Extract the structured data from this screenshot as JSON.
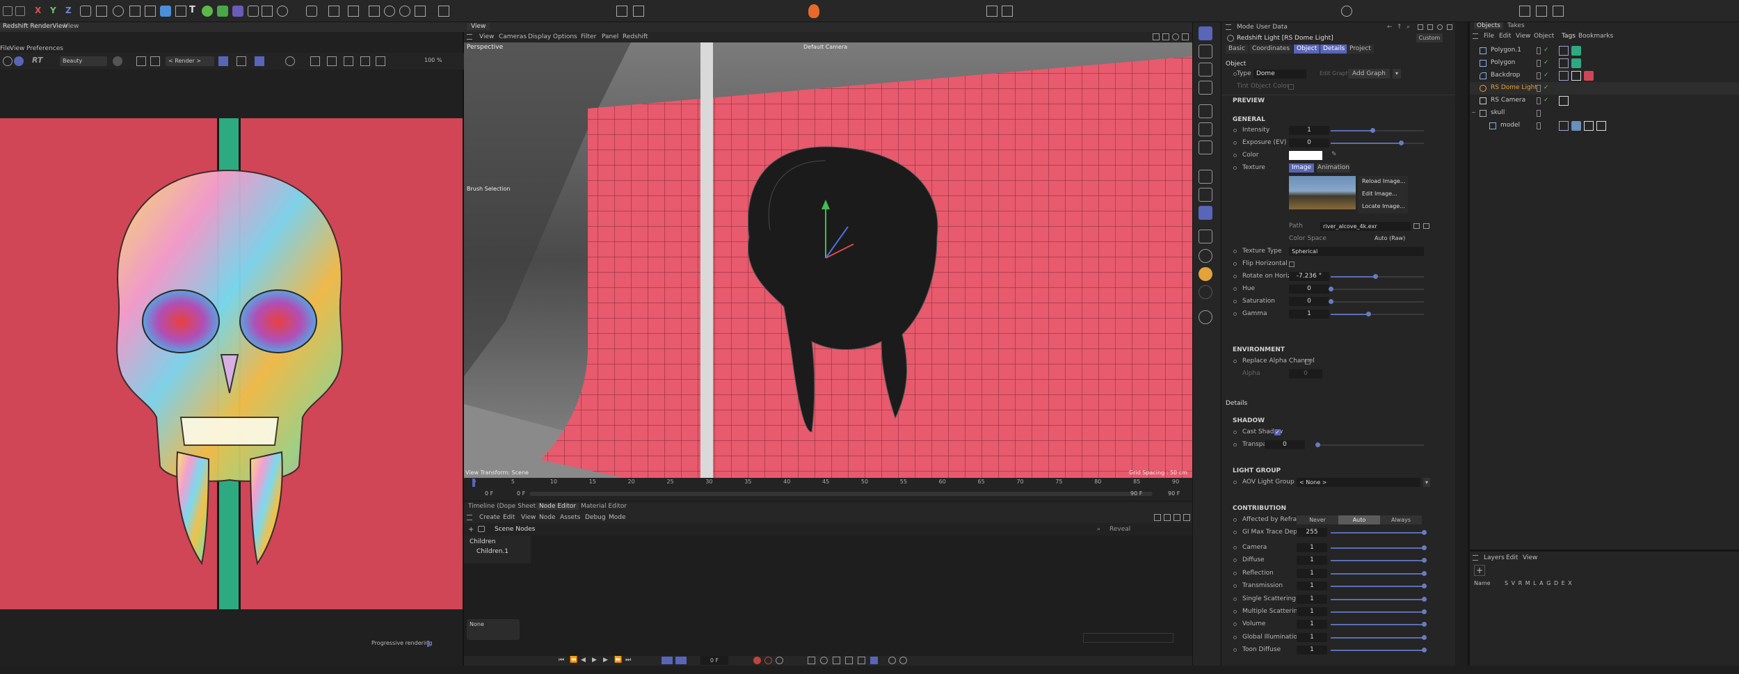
{
  "render_view": {
    "title": "Redshift RenderView",
    "tab": "View",
    "menu": [
      "File",
      "View",
      "Preferences"
    ],
    "rt_label": "RT",
    "aov": "Beauty",
    "render_scope": "< Render >",
    "zoom": "100 %",
    "status": "Progressive rendering"
  },
  "viewport": {
    "tab": "View",
    "menu": [
      "View",
      "Cameras",
      "Display",
      "Options",
      "Filter",
      "Panel",
      "Redshift"
    ],
    "label": "Perspective",
    "camera": "Default Camera",
    "brush": "Brush Selection",
    "view_transform": "View Transform: Scene",
    "grid_spacing": "Grid Spacing : 50 cm",
    "ticks": [
      "0",
      "5",
      "10",
      "15",
      "20",
      "25",
      "30",
      "35",
      "40",
      "45",
      "50",
      "55",
      "60",
      "65",
      "70",
      "75",
      "80",
      "85",
      "90"
    ],
    "time_start": "0 F",
    "time_start2": "0 F",
    "time_end": "90 F",
    "time_end2": "90 F"
  },
  "node_editor": {
    "tabs": [
      "Timeline (Dope Sheet)",
      "Node Editor",
      "Material Editor"
    ],
    "menu": [
      "Create",
      "Edit",
      "View",
      "Node",
      "Assets",
      "Debug",
      "Mode"
    ],
    "header": "Scene Nodes",
    "search": "Reveal",
    "tree": [
      "Children",
      "Children.1"
    ],
    "node_box": "None"
  },
  "bottom": {
    "frame": "0 F"
  },
  "attributes": {
    "menu": [
      "Mode",
      "User Data"
    ],
    "object_title": "Redshift Light [RS Dome Light]",
    "layout": "Custom",
    "tabs": [
      "Basic",
      "Coordinates",
      "Object",
      "Details",
      "Project"
    ],
    "section_object": "Object",
    "type_label": "Type",
    "type_value": "Dome",
    "edit_graph": "Edit Graph",
    "add_graph": "Add Graph",
    "tint_object_color": "Tint Object Color",
    "preview": "PREVIEW",
    "general": "GENERAL",
    "intensity": {
      "label": "Intensity",
      "value": "1",
      "fraction": 0.45
    },
    "exposure": {
      "label": "Exposure (EV)",
      "value": "0",
      "fraction": 0.75
    },
    "color_label": "Color",
    "texture_label": "Texture",
    "texture_tabs": [
      "Image",
      "Animation"
    ],
    "texture_menu": [
      "Reload Image...",
      "Edit Image...",
      "Locate Image..."
    ],
    "path_label": "Path",
    "path_value": "river_alcove_4k.exr",
    "color_space_label": "Color Space",
    "color_space_value": "Auto (Raw)",
    "texture_type": {
      "label": "Texture Type",
      "value": "Spherical"
    },
    "flip_horizontal": "Flip Horizontal",
    "rotate": {
      "label": "Rotate on Horizon",
      "value": "-7.236 °",
      "fraction": 0.48
    },
    "hue": {
      "label": "Hue",
      "value": "0",
      "fraction": 0.0
    },
    "saturation": {
      "label": "Saturation",
      "value": "0",
      "fraction": 0.0
    },
    "gamma": {
      "label": "Gamma",
      "value": "1",
      "fraction": 0.4
    },
    "environment": "ENVIRONMENT",
    "replace_alpha": "Replace Alpha Channel",
    "alpha": {
      "label": "Alpha",
      "value": "0"
    },
    "details": "Details",
    "shadow": "SHADOW",
    "cast_shadow": "Cast Shadow",
    "transparency": {
      "label": "Transparency",
      "value": "0",
      "fraction": 0.0
    },
    "light_group": "LIGHT GROUP",
    "aov_light_group": {
      "label": "AOV Light Group",
      "value": "< None >"
    },
    "contribution": "CONTRIBUTION",
    "affected_by_refraction": {
      "label": "Affected by Refraction",
      "options": [
        "Never",
        "Auto",
        "Always"
      ]
    },
    "gi_max_trace_depth": {
      "label": "GI Max Trace Depth",
      "value": "255",
      "fraction": 1.0
    },
    "contrib_rows": [
      {
        "label": "Camera",
        "value": "1"
      },
      {
        "label": "Diffuse",
        "value": "1"
      },
      {
        "label": "Reflection",
        "value": "1"
      },
      {
        "label": "Transmission",
        "value": "1"
      },
      {
        "label": "Single Scattering",
        "value": "1"
      },
      {
        "label": "Multiple Scattering",
        "value": "1"
      },
      {
        "label": "Volume",
        "value": "1"
      },
      {
        "label": "Global Illumination",
        "value": "1"
      },
      {
        "label": "Toon Diffuse",
        "value": "1"
      }
    ]
  },
  "objects": {
    "tabs": [
      "Objects",
      "Takes"
    ],
    "menu": [
      "File",
      "Edit",
      "View",
      "Object",
      "Tags",
      "Bookmarks"
    ],
    "rows": [
      {
        "name": "Polygon.1"
      },
      {
        "name": "Polygon"
      },
      {
        "name": "Backdrop"
      },
      {
        "name": "RS Dome Light"
      },
      {
        "name": "RS Camera"
      },
      {
        "name": "skull"
      },
      {
        "name": "model"
      }
    ],
    "layers_menu": [
      "Layers",
      "Edit",
      "View"
    ],
    "layers_header_name": "Name",
    "layers_cols": "S V R M L A G D E X"
  },
  "colors": {
    "accent": "#5865b8",
    "canvas_bg": "#d04656",
    "stripe": "#2eaa80",
    "active_light": "#e4a23a"
  }
}
